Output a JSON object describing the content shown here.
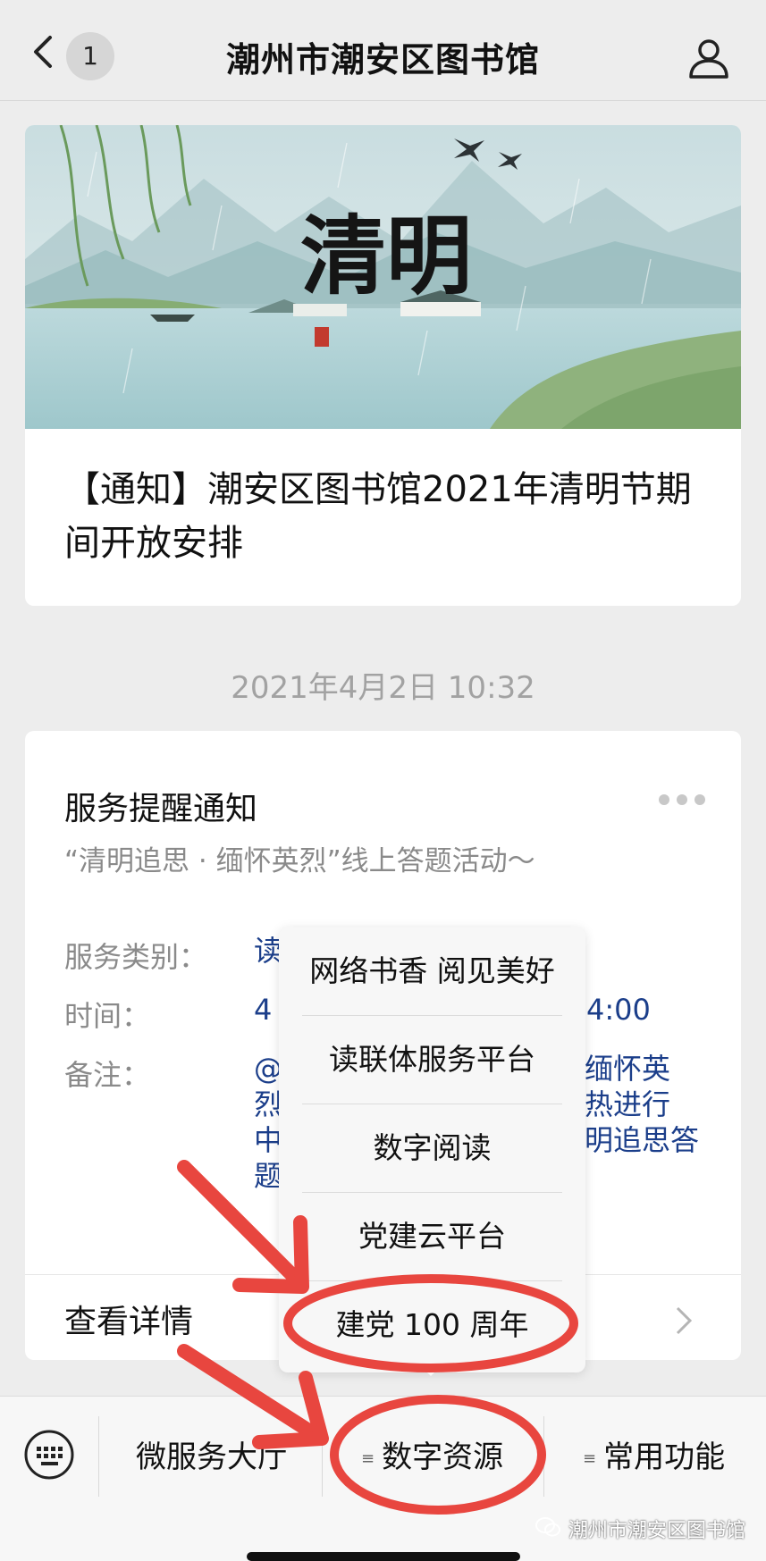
{
  "nav": {
    "back_count": "1",
    "title": "潮州市潮安区图书馆"
  },
  "article": {
    "banner_calligraphy": "清明",
    "title": "【通知】潮安区图书馆2021年清明节期间开放安排"
  },
  "timestamp": "2021年4月2日 10:32",
  "card": {
    "title": "服务提醒通知",
    "subtitle": "“清明追思 · 缅怀英烈”线上答题活动～",
    "rows": [
      {
        "label": "服务类别：",
        "value_left": "读",
        "value_right": ""
      },
      {
        "label": "时间：",
        "value_left": "4",
        "value_right": "4:00"
      },
      {
        "label": "备注：",
        "value_left": "@\n烈\n中\n题",
        "value_right": "缅怀英\n热进行\n明追思答"
      }
    ],
    "detail_label": "查看详情"
  },
  "popup": {
    "items": [
      "网络书香 阅见美好",
      "读联体服务平台",
      "数字阅读",
      "党建云平台",
      "建党 100 周年"
    ]
  },
  "bottom_menu": {
    "items": [
      "微服务大厅",
      "数字资源",
      "常用功能"
    ],
    "indicator": "≡"
  },
  "watermark": "潮州市潮安区图书馆",
  "colors": {
    "annotation": "#e8463f",
    "link": "#1b3e8a",
    "muted": "#8a8a8a"
  },
  "icons": [
    "back-arrow-icon",
    "user-icon",
    "more-dots-icon",
    "chevron-right-icon",
    "keyboard-icon",
    "wechat-icon"
  ]
}
